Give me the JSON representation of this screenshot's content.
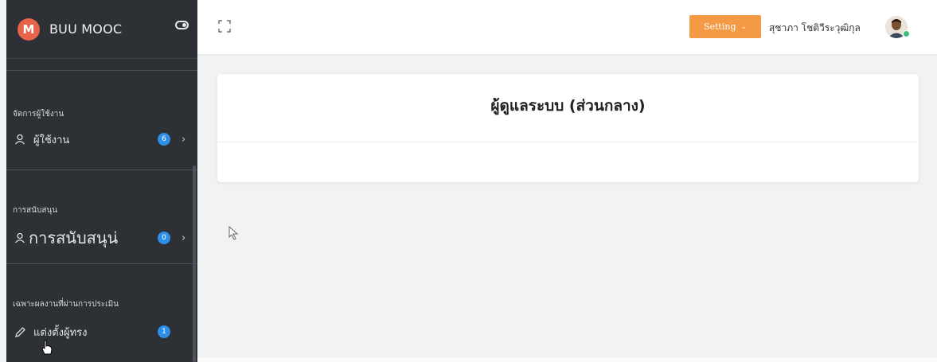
{
  "sidebar": {
    "brand": {
      "logo_letter": "M",
      "name": "BUU MOOC",
      "toggle_icon": "toggle-icon"
    },
    "sections": [
      {
        "title": "จัดการผู้ใช้งาน",
        "item": {
          "icon": "user-icon",
          "label": "ผู้ใช้งาน",
          "badge": "6",
          "chevron": "›"
        }
      },
      {
        "title": "การสนับสนุน",
        "item": {
          "icon": "user-icon",
          "label": "การสนับสนุน่",
          "badge": "0",
          "chevron": "›"
        }
      },
      {
        "title": "เฉพาะผลงานที่ผ่านการประเมิน",
        "item": {
          "icon": "pencil-icon",
          "label": "แต่งตั้งผู้ทรง",
          "badge": "1"
        }
      }
    ]
  },
  "header": {
    "expand_icon": "expand-icon",
    "setting_label": "Setting",
    "setting_caret": "⌄",
    "username": "สุชาภา โชติวีระวุฒิกุล",
    "avatar_icon": "avatar-icon"
  },
  "main": {
    "card_title": "ผู้ดูแลระบบ (ส่วนกลาง)"
  },
  "colors": {
    "sidebar_bg": "#2d3136",
    "accent_orange": "#f59a44",
    "badge_blue": "#2d8fe8",
    "brand_red": "#e8634a",
    "online_green": "#3bbf7a"
  }
}
